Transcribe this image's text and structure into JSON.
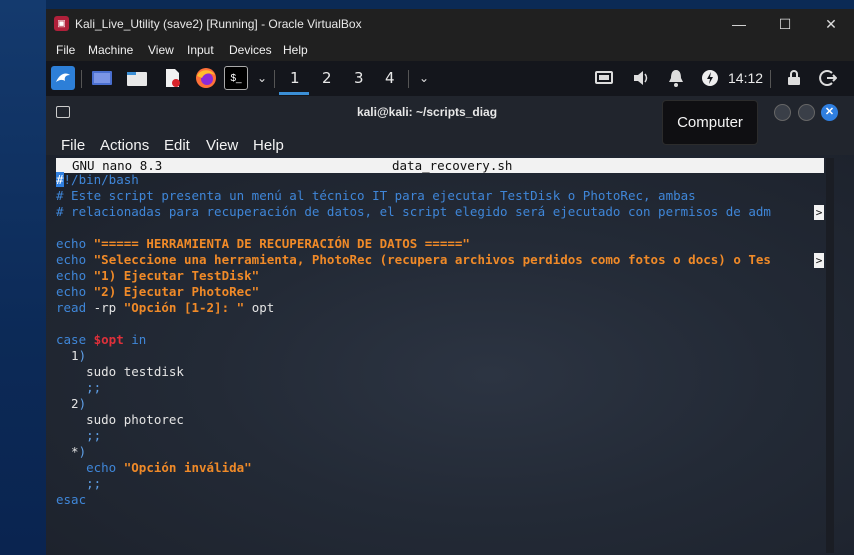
{
  "window": {
    "title": "Kali_Live_Utility (save2) [Running] - Oracle VirtualBox",
    "minimize": "—",
    "maximize": "☐",
    "close": "✕"
  },
  "menubar": [
    "File",
    "Machine",
    "View",
    "Input",
    "Devices",
    "Help"
  ],
  "panel": {
    "workspaces": [
      "1",
      "2",
      "3",
      "4"
    ],
    "active_workspace": "1",
    "clock": "14:12",
    "icons": [
      "kali-dragon-icon",
      "desktop-icon",
      "file-manager-icon",
      "text-editor-icon",
      "firefox-icon",
      "terminal-icon",
      "chevron-down-icon",
      "display-icon",
      "volume-icon",
      "notifications-icon",
      "power-icon",
      "lock-icon",
      "logout-icon"
    ]
  },
  "terminal": {
    "title": "kali@kali: ~/scripts_diag",
    "menu": [
      "File",
      "Actions",
      "Edit",
      "View",
      "Help"
    ],
    "tooltip": "Computer"
  },
  "nano": {
    "version": "GNU nano 8.3",
    "filename": "data_recovery.sh",
    "truncation_marker": ">"
  },
  "code": {
    "l1_hash": "#",
    "l1_rest": "!/bin/bash",
    "l2": "# Este script presenta un menú al técnico IT para ejecutar TestDisk o PhotoRec, ambas",
    "l3": "# relacionadas para recuperación de datos, el script elegido será ejecutado con permisos de adm",
    "l5_kw": "echo",
    "l5_str": "\"===== HERRAMIENTA DE RECUPERACIÓN DE DATOS =====\"",
    "l6_kw": "echo",
    "l6_str": "\"Seleccione una herramienta, PhotoRec (recupera archivos perdidos como fotos o docs) o Tes",
    "l7_kw": "echo",
    "l7_str": "\"1) Ejecutar TestDisk\"",
    "l8_kw": "echo",
    "l8_str": "\"2) Ejecutar PhotoRec\"",
    "l9_kw": "read",
    "l9_flag": " -rp ",
    "l9_str": "\"Opción [1-2]: \"",
    "l9_var": " opt",
    "l11_kw": "case",
    "l11_var": " $opt",
    "l11_in": " in",
    "l12_num": "  1",
    "l12_paren": ")",
    "l13": "    sudo testdisk",
    "l14": "    ;;",
    "l15_num": "  2",
    "l15_paren": ")",
    "l16": "    sudo photorec",
    "l17": "    ;;",
    "l18_star": "  *",
    "l18_paren": ")",
    "l19_kw": "    echo",
    "l19_str": " \"Opción inválida\"",
    "l20": "    ;;",
    "l21": "esac"
  }
}
